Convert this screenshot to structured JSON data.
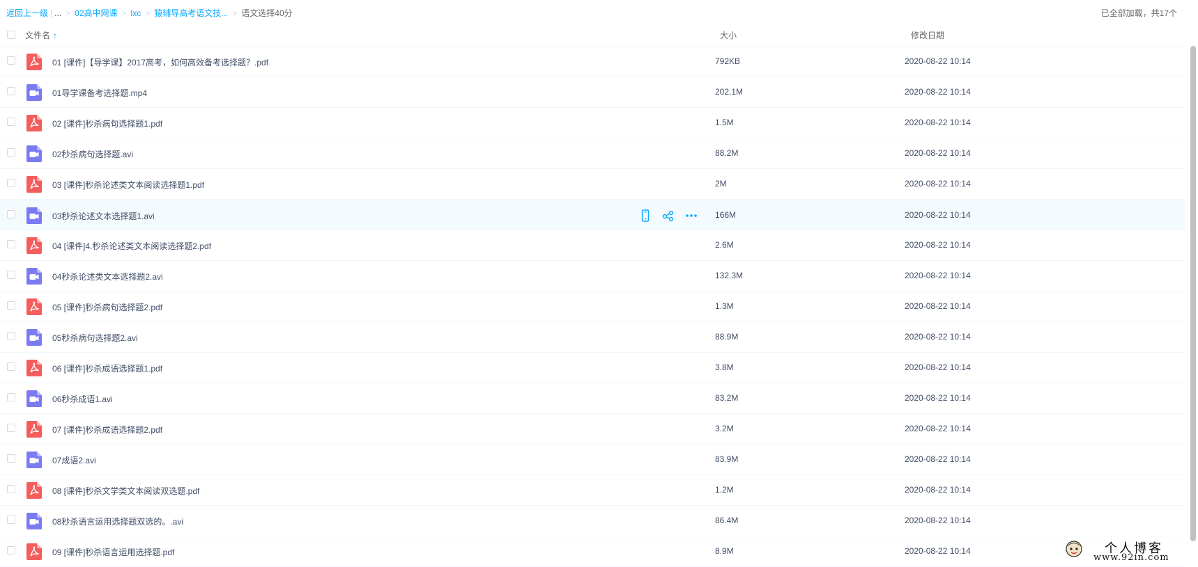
{
  "breadcrumb": {
    "back": "返回上一级",
    "ellipsis": "...",
    "items": [
      "02高中网课",
      "lxc",
      "猿辅导高考语文技..."
    ],
    "current": "语文选择40分"
  },
  "status": "已全部加载，共17个",
  "header": {
    "name": "文件名",
    "sort_arrow": "↑",
    "size": "大小",
    "date": "修改日期"
  },
  "colors": {
    "accent": "#09aaff",
    "pdf": "#f55d5d",
    "video": "#7b7bf1",
    "hover": "#f4fbff"
  },
  "files": [
    {
      "name": "01 [课件]【导学课】2017高考，如何高效备考选择题？.pdf",
      "type": "pdf-icon",
      "size": "792KB",
      "date": "2020-08-22 10:14"
    },
    {
      "name": "01导学课备考选择题.mp4",
      "type": "video-icon",
      "size": "202.1M",
      "date": "2020-08-22 10:14"
    },
    {
      "name": "02 [课件]秒杀病句选择题1.pdf",
      "type": "pdf-icon",
      "size": "1.5M",
      "date": "2020-08-22 10:14"
    },
    {
      "name": "02秒杀病句选择题.avi",
      "type": "video-icon",
      "size": "88.2M",
      "date": "2020-08-22 10:14"
    },
    {
      "name": "03 [课件]秒杀论述类文本阅读选择题1.pdf",
      "type": "pdf-icon",
      "size": "2M",
      "date": "2020-08-22 10:14"
    },
    {
      "name": "03秒杀论述文本选择题1.avi",
      "type": "video-icon",
      "size": "166M",
      "date": "2020-08-22 10:14"
    },
    {
      "name": "04 [课件]4.秒杀论述类文本阅读选择题2.pdf",
      "type": "pdf-icon",
      "size": "2.6M",
      "date": "2020-08-22 10:14"
    },
    {
      "name": "04秒杀论述类文本选择题2.avi",
      "type": "video-icon",
      "size": "132.3M",
      "date": "2020-08-22 10:14"
    },
    {
      "name": "05 [课件]秒杀病句选择题2.pdf",
      "type": "pdf-icon",
      "size": "1.3M",
      "date": "2020-08-22 10:14"
    },
    {
      "name": "05秒杀病句选择题2.avi",
      "type": "video-icon",
      "size": "88.9M",
      "date": "2020-08-22 10:14"
    },
    {
      "name": "06 [课件]秒杀成语选择题1.pdf",
      "type": "pdf-icon",
      "size": "3.8M",
      "date": "2020-08-22 10:14"
    },
    {
      "name": "06秒杀成语1.avi",
      "type": "video-icon",
      "size": "83.2M",
      "date": "2020-08-22 10:14"
    },
    {
      "name": "07 [课件]秒杀成语选择题2.pdf",
      "type": "pdf-icon",
      "size": "3.2M",
      "date": "2020-08-22 10:14"
    },
    {
      "name": "07成语2.avi",
      "type": "video-icon",
      "size": "83.9M",
      "date": "2020-08-22 10:14"
    },
    {
      "name": "08 [课件]秒杀文学类文本阅读双选题.pdf",
      "type": "pdf-icon",
      "size": "1.2M",
      "date": "2020-08-22 10:14"
    },
    {
      "name": "08秒杀语言运用选择题双选的。.avi",
      "type": "video-icon",
      "size": "86.4M",
      "date": "2020-08-22 10:14"
    },
    {
      "name": "09 [课件]秒杀语言运用选择题.pdf",
      "type": "pdf-icon",
      "size": "8.9M",
      "date": "2020-08-22 10:14"
    }
  ],
  "hover_row": 5,
  "row_actions": [
    "phone-icon",
    "share-icon",
    "more-icon"
  ],
  "watermark": {
    "title": "个人博客",
    "url": "www.92in.com"
  }
}
